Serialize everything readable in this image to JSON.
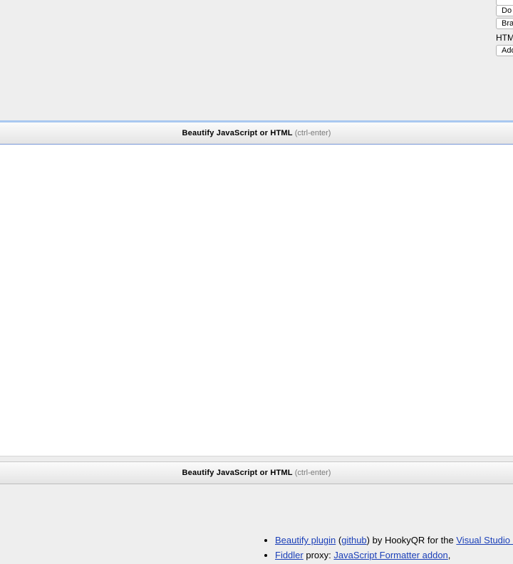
{
  "options": {
    "buttons": [
      "",
      "Do",
      "Bra",
      "Add"
    ],
    "html_label": "HTML"
  },
  "beautify_bar": {
    "label": "Beautify JavaScript or HTML",
    "hint": "(ctrl-enter)"
  },
  "links": [
    {
      "parts": [
        {
          "text": "Beautify plugin",
          "link": true
        },
        {
          "text": " (",
          "link": false
        },
        {
          "text": "github",
          "link": true
        },
        {
          "text": ") by HookyQR for the ",
          "link": false
        },
        {
          "text": "Visual Studio Code",
          "link": true
        }
      ]
    },
    {
      "parts": [
        {
          "text": "Fiddler",
          "link": true
        },
        {
          "text": " proxy: ",
          "link": false
        },
        {
          "text": "JavaScript Formatter addon",
          "link": true
        },
        {
          "text": ",",
          "link": false
        }
      ]
    }
  ]
}
